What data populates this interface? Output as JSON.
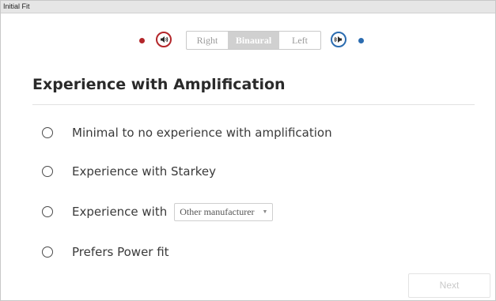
{
  "window": {
    "title": "Initial Fit"
  },
  "side_selector": {
    "options": [
      "Right",
      "Binaural",
      "Left"
    ],
    "selected": "Binaural",
    "right_color": "#b3262a",
    "left_color": "#2b6cb0",
    "right_icon": "speaker-right-icon",
    "left_icon": "speaker-left-icon"
  },
  "section": {
    "title": "Experience with Amplification",
    "options": [
      {
        "label": "Minimal to no experience with amplification"
      },
      {
        "label": "Experience with Starkey"
      },
      {
        "label": "Experience with",
        "dropdown_value": "Other manufacturer"
      },
      {
        "label": "Prefers Power fit"
      }
    ]
  },
  "footer": {
    "next_label": "Next"
  }
}
